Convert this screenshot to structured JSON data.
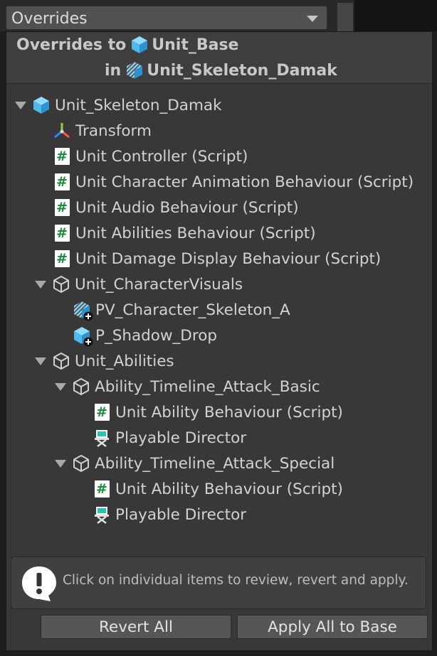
{
  "dropdown": {
    "value": "Overrides"
  },
  "header": {
    "line1_prefix": "Overrides to",
    "line1_target": "Unit_Base",
    "line2_prefix": "in",
    "line2_target": "Unit_Skeleton_Damak"
  },
  "tree": {
    "root": "Unit_Skeleton_Damak",
    "transform": "Transform",
    "unit_controller": "Unit Controller (Script)",
    "anim_behaviour": "Unit Character Animation Behaviour (Script)",
    "audio_behaviour": "Unit Audio Behaviour (Script)",
    "abilities_behaviour": "Unit Abilities Behaviour (Script)",
    "damage_display": "Unit Damage Display Behaviour (Script)",
    "character_visuals": "Unit_CharacterVisuals",
    "pv_character": "PV_Character_Skeleton_A",
    "p_shadow": "P_Shadow_Drop",
    "unit_abilities": "Unit_Abilities",
    "ability_basic": "Ability_Timeline_Attack_Basic",
    "ability_basic_script": "Unit Ability Behaviour (Script)",
    "ability_basic_director": "Playable Director",
    "ability_special": "Ability_Timeline_Attack_Special",
    "ability_special_script": "Unit Ability Behaviour (Script)",
    "ability_special_director": "Playable Director"
  },
  "info": {
    "message": "Click on individual items to review, revert and apply."
  },
  "buttons": {
    "revert_all": "Revert All",
    "apply_all": "Apply All to Base"
  },
  "colors": {
    "prefab_blue": "#4fc3f7",
    "script_green": "#1e8a3c",
    "background": "#383838"
  }
}
